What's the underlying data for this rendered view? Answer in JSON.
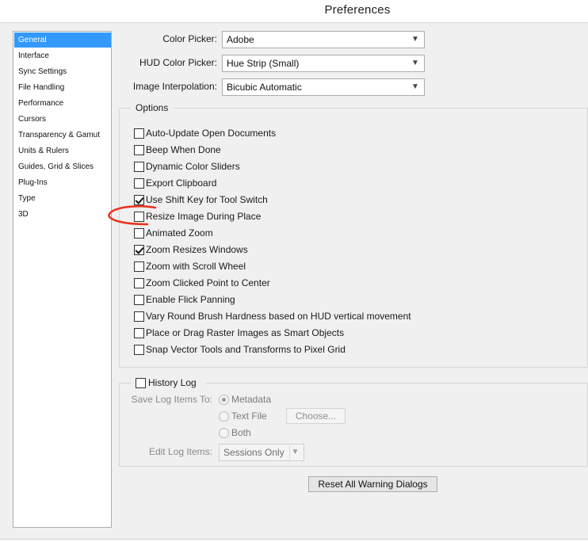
{
  "window": {
    "title": "Preferences"
  },
  "sidebar": {
    "items": [
      {
        "label": "General",
        "selected": true
      },
      {
        "label": "Interface"
      },
      {
        "label": "Sync Settings"
      },
      {
        "label": "File Handling"
      },
      {
        "label": "Performance"
      },
      {
        "label": "Cursors"
      },
      {
        "label": "Transparency & Gamut"
      },
      {
        "label": "Units & Rulers"
      },
      {
        "label": "Guides, Grid & Slices"
      },
      {
        "label": "Plug-Ins"
      },
      {
        "label": "Type"
      },
      {
        "label": "3D"
      }
    ]
  },
  "general": {
    "color_picker": {
      "label": "Color Picker:",
      "value": "Adobe"
    },
    "hud_color_picker": {
      "label": "HUD Color Picker:",
      "value": "Hue Strip (Small)"
    },
    "image_interpolation": {
      "label": "Image Interpolation:",
      "value": "Bicubic Automatic"
    }
  },
  "options": {
    "legend": "Options",
    "items": [
      {
        "label": "Auto-Update Open Documents",
        "checked": false
      },
      {
        "label": "Beep When Done",
        "checked": false
      },
      {
        "label": "Dynamic Color Sliders",
        "checked": false
      },
      {
        "label": "Export Clipboard",
        "checked": false
      },
      {
        "label": "Use Shift Key for Tool Switch",
        "checked": true
      },
      {
        "label": "Resize Image During Place",
        "checked": false
      },
      {
        "label": "Animated Zoom",
        "checked": false
      },
      {
        "label": "Zoom Resizes Windows",
        "checked": true
      },
      {
        "label": "Zoom with Scroll Wheel",
        "checked": false
      },
      {
        "label": "Zoom Clicked Point to Center",
        "checked": false
      },
      {
        "label": "Enable Flick Panning",
        "checked": false
      },
      {
        "label": "Vary Round Brush Hardness based on HUD vertical movement",
        "checked": false
      },
      {
        "label": "Place or Drag Raster Images as Smart Objects",
        "checked": false
      },
      {
        "label": "Snap Vector Tools and Transforms to Pixel Grid",
        "checked": false
      }
    ]
  },
  "history_log": {
    "label": "History Log",
    "checked": false,
    "save_to_label": "Save Log Items To:",
    "radios": [
      {
        "label": "Metadata",
        "checked": true
      },
      {
        "label": "Text File",
        "checked": false
      },
      {
        "label": "Both",
        "checked": false
      }
    ],
    "choose_button": "Choose...",
    "edit_items_label": "Edit Log Items:",
    "edit_items_value": "Sessions Only"
  },
  "reset_button": "Reset All Warning Dialogs",
  "annotation": {
    "color": "#e8321e"
  }
}
